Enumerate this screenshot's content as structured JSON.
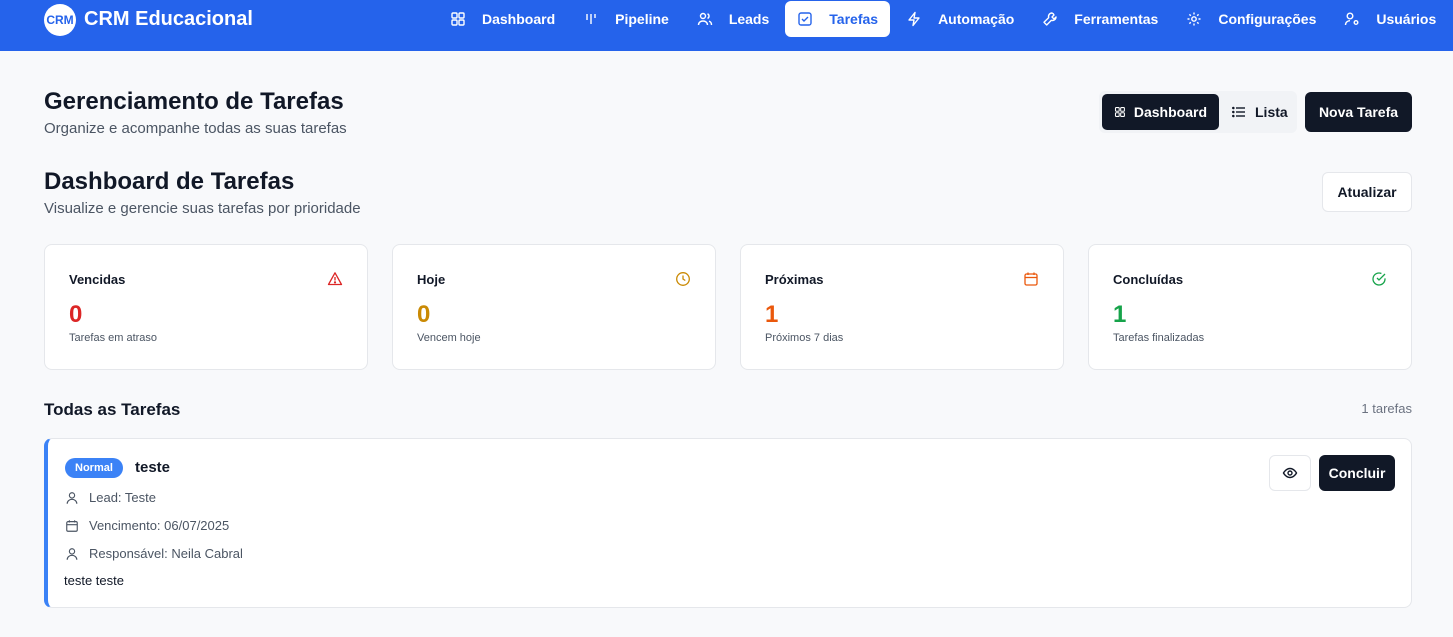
{
  "app": {
    "logo_text": "CRM",
    "name": "CRM Educacional"
  },
  "nav": {
    "items": [
      {
        "label": "Dashboard",
        "icon": "layout-grid-icon",
        "active": false
      },
      {
        "label": "Pipeline",
        "icon": "pipeline-icon",
        "active": false
      },
      {
        "label": "Leads",
        "icon": "users-icon",
        "active": false
      },
      {
        "label": "Tarefas",
        "icon": "checkbox-icon",
        "active": true
      },
      {
        "label": "Automação",
        "icon": "zap-icon",
        "active": false
      },
      {
        "label": "Ferramentas",
        "icon": "wrench-icon",
        "active": false
      },
      {
        "label": "Configurações",
        "icon": "gear-icon",
        "active": false
      },
      {
        "label": "Usuários",
        "icon": "user-cog-icon",
        "active": false
      }
    ]
  },
  "header": {
    "title": "Gerenciamento de Tarefas",
    "subtitle": "Organize e acompanhe todas as suas tarefas",
    "view_dashboard": "Dashboard",
    "view_list": "Lista",
    "new_task": "Nova Tarefa"
  },
  "dashboard": {
    "title": "Dashboard de Tarefas",
    "subtitle": "Visualize e gerencie suas tarefas por prioridade",
    "refresh": "Atualizar"
  },
  "stats": [
    {
      "label": "Vencidas",
      "value": "0",
      "desc": "Tarefas em atraso",
      "icon": "alert-triangle-icon",
      "color": "#dc2626"
    },
    {
      "label": "Hoje",
      "value": "0",
      "desc": "Vencem hoje",
      "icon": "clock-icon",
      "color": "#ca8a04"
    },
    {
      "label": "Próximas",
      "value": "1",
      "desc": "Próximos 7 dias",
      "icon": "calendar-icon",
      "color": "#ea580c"
    },
    {
      "label": "Concluídas",
      "value": "1",
      "desc": "Tarefas finalizadas",
      "icon": "check-circle-icon",
      "color": "#16a34a"
    }
  ],
  "list": {
    "title": "Todas as Tarefas",
    "count": "1 tarefas"
  },
  "task": {
    "priority": "Normal",
    "title": "teste",
    "lead": "Lead: Teste",
    "due": "Vencimento: 06/07/2025",
    "owner": "Responsável: Neila Cabral",
    "description": "teste teste",
    "complete_label": "Concluir"
  },
  "colors": {
    "primary": "#2563eb",
    "dark": "#111827",
    "badge": "#3b82f6"
  }
}
